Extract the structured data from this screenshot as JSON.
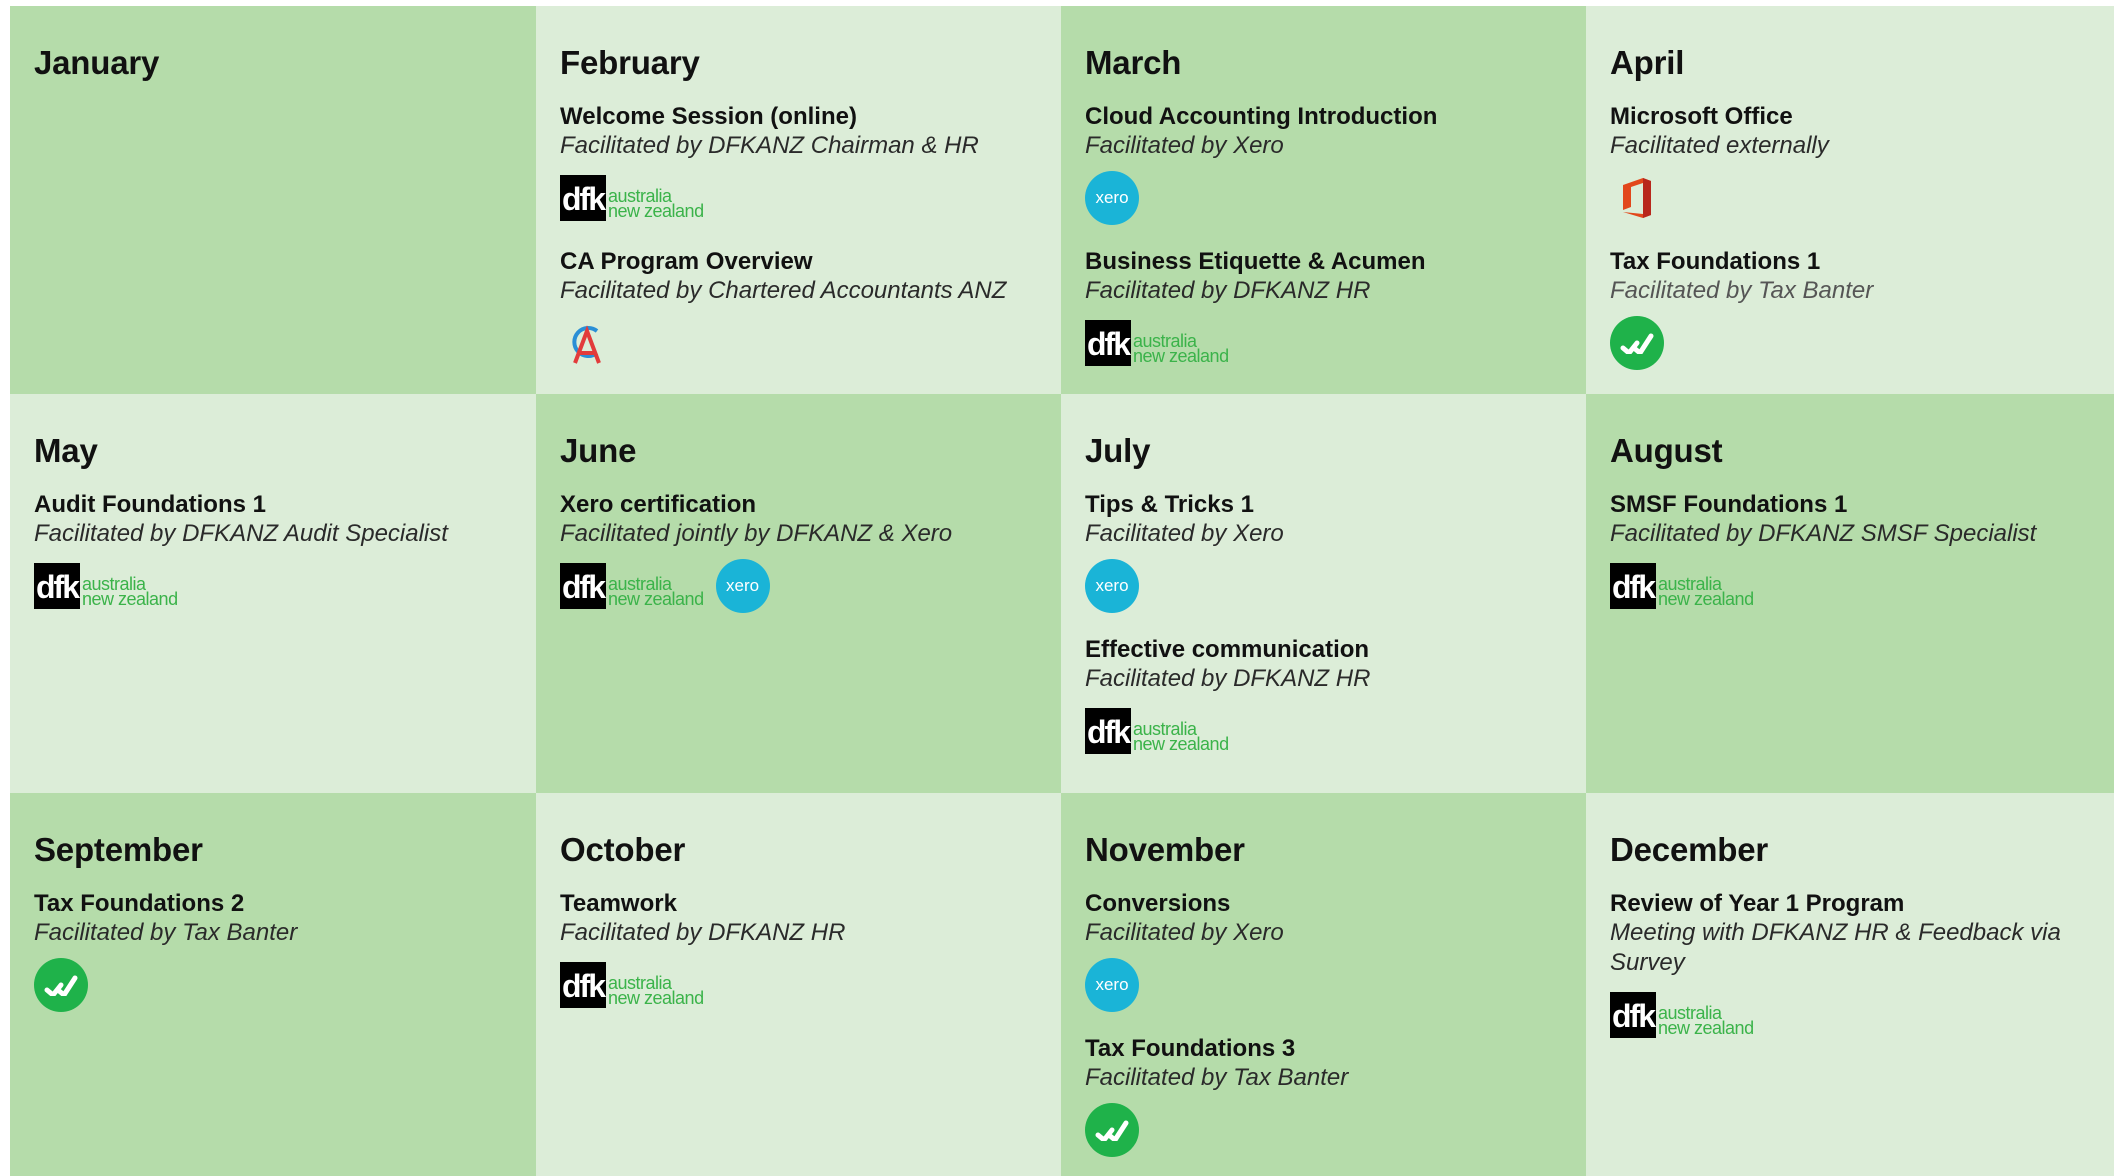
{
  "logos": {
    "dfk": {
      "mark": "dfk",
      "line1": "australia",
      "line2": "new zealand",
      "color_mark_bg": "#000000",
      "color_text": "#3bb34a"
    },
    "xero": {
      "mark": "xero",
      "color": "#1ab4d7"
    },
    "tax_banter": {
      "icon": "tax-banter-check-icon",
      "color": "#1fb24a"
    },
    "ca_anz": {
      "icon": "chartered-accountants-icon"
    },
    "microsoft_office": {
      "icon": "microsoft-office-icon"
    }
  },
  "months": [
    {
      "name": "January",
      "events": []
    },
    {
      "name": "February",
      "events": [
        {
          "title": "Welcome Session (online)",
          "facilitator": "Facilitated by DFKANZ Chairman & HR",
          "logos": [
            "dfk"
          ]
        },
        {
          "title": "CA Program Overview",
          "facilitator": "Facilitated by Chartered Accountants ANZ",
          "logos": [
            "ca_anz"
          ]
        }
      ]
    },
    {
      "name": "March",
      "events": [
        {
          "title": "Cloud Accounting Introduction",
          "facilitator": "Facilitated by Xero",
          "logos": [
            "xero"
          ]
        },
        {
          "title": "Business Etiquette & Acumen",
          "facilitator": "Facilitated by DFKANZ HR",
          "logos": [
            "dfk"
          ]
        }
      ]
    },
    {
      "name": "April",
      "events": [
        {
          "title": "Microsoft Office",
          "facilitator": "Facilitated externally",
          "logos": [
            "microsoft_office"
          ]
        },
        {
          "title": "Tax Foundations 1",
          "facilitator": "Facilitated by Tax Banter",
          "logos": [
            "tax_banter"
          ]
        }
      ]
    },
    {
      "name": "May",
      "events": [
        {
          "title": "Audit Foundations 1",
          "facilitator": "Facilitated by DFKANZ Audit Specialist",
          "logos": [
            "dfk"
          ]
        }
      ]
    },
    {
      "name": "June",
      "events": [
        {
          "title": "Xero certification",
          "facilitator": "Facilitated jointly by DFKANZ & Xero",
          "logos": [
            "dfk",
            "xero"
          ]
        }
      ]
    },
    {
      "name": "July",
      "events": [
        {
          "title": "Tips & Tricks 1",
          "facilitator": "Facilitated by Xero",
          "logos": [
            "xero"
          ]
        },
        {
          "title": "Effective communication",
          "facilitator": "Facilitated by DFKANZ HR",
          "logos": [
            "dfk"
          ]
        }
      ]
    },
    {
      "name": "August",
      "events": [
        {
          "title": "SMSF Foundations 1",
          "facilitator": "Facilitated by DFKANZ SMSF Specialist",
          "logos": [
            "dfk"
          ]
        }
      ]
    },
    {
      "name": "September",
      "events": [
        {
          "title": "Tax Foundations 2",
          "facilitator": "Facilitated by Tax Banter",
          "logos": [
            "tax_banter"
          ]
        }
      ]
    },
    {
      "name": "October",
      "events": [
        {
          "title": "Teamwork",
          "facilitator": "Facilitated by DFKANZ HR",
          "logos": [
            "dfk"
          ]
        }
      ]
    },
    {
      "name": "November",
      "events": [
        {
          "title": "Conversions",
          "facilitator": "Facilitated by Xero",
          "logos": [
            "xero"
          ]
        },
        {
          "title": "Tax Foundations 3",
          "facilitator": "Facilitated by Tax Banter",
          "logos": [
            "tax_banter"
          ]
        }
      ]
    },
    {
      "name": "December",
      "events": [
        {
          "title": "Review of Year 1 Program",
          "facilitator": "Meeting with DFKANZ HR & Feedback via Survey",
          "logos": [
            "dfk"
          ]
        }
      ]
    }
  ],
  "colors": {
    "cell_dark": "#b5dcaa",
    "cell_light": "#dcedd8"
  }
}
